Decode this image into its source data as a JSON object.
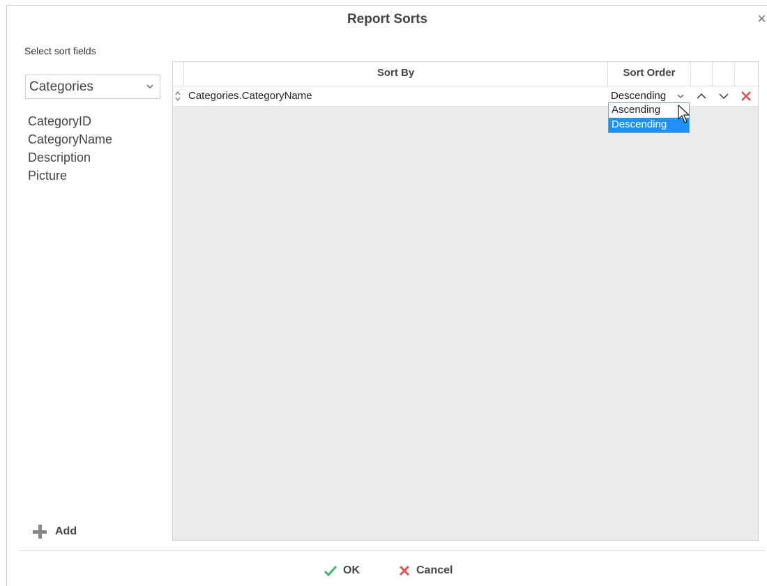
{
  "dialog": {
    "title": "Report Sorts",
    "close_icon": "close-icon"
  },
  "left": {
    "select_label": "Select sort fields",
    "table_select": {
      "value": "Categories",
      "icon": "chevron-down-icon"
    },
    "fields": [
      "CategoryID",
      "CategoryName",
      "Description",
      "Picture"
    ],
    "add_label": "Add"
  },
  "grid": {
    "headers": {
      "sort_by": "Sort By",
      "sort_order": "Sort Order"
    },
    "rows": [
      {
        "sort_by": "Categories.CategoryName",
        "sort_order": "Descending"
      }
    ],
    "order_options": [
      "Ascending",
      "Descending"
    ],
    "selected_option": "Descending",
    "row_icons": [
      "drag-handle-icon",
      "chevron-up-icon",
      "chevron-down-icon",
      "delete-icon"
    ]
  },
  "footer": {
    "ok_label": "OK",
    "cancel_label": "Cancel"
  },
  "colors": {
    "ok_check": "#3cb371",
    "cancel_x": "#d9534f",
    "delete_x": "#e04a4a",
    "selection": "#1e90ff"
  }
}
